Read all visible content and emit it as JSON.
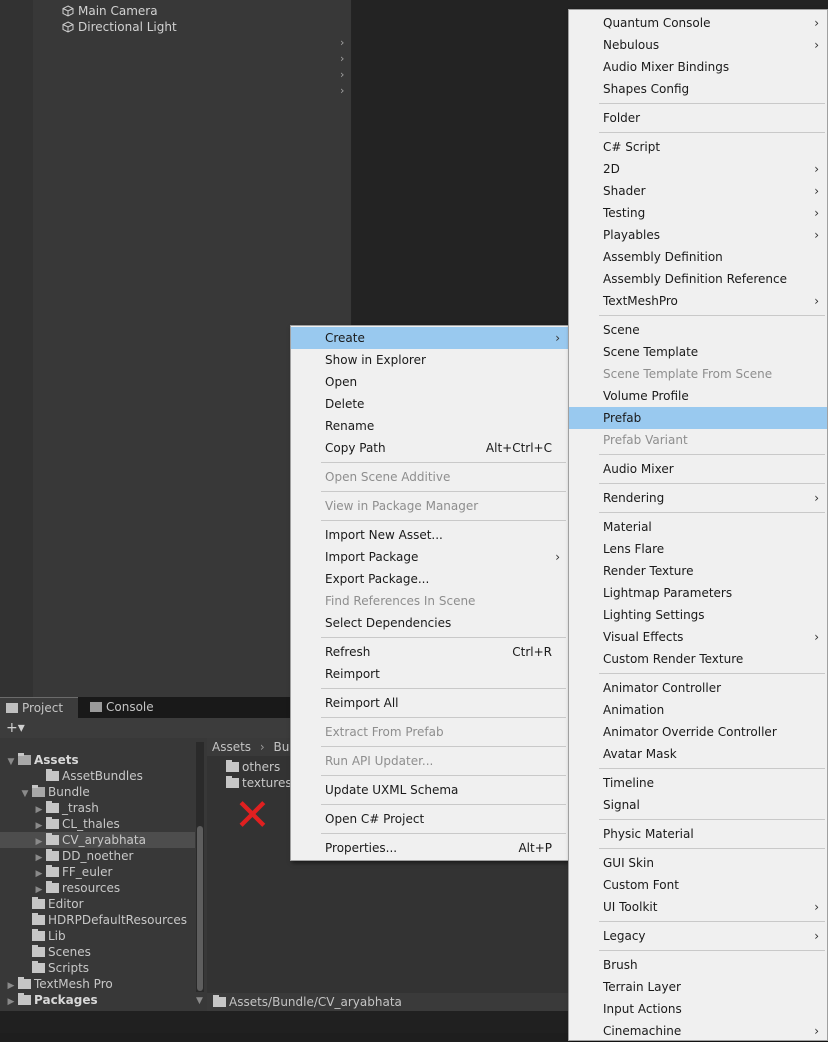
{
  "hierarchy": {
    "items": [
      {
        "label": "Main Camera",
        "icon": "gameobject-cube-icon"
      },
      {
        "label": "Directional Light",
        "icon": "gameobject-cube-icon"
      }
    ]
  },
  "tabs": {
    "project": "Project",
    "console": "Console"
  },
  "toolbar": {
    "add_label": "+▾"
  },
  "tree": [
    {
      "label": "Assets",
      "bold": true,
      "expanded": true
    },
    {
      "label": "AssetBundles"
    },
    {
      "label": "Bundle",
      "expanded": true
    },
    {
      "label": "_trash"
    },
    {
      "label": "CL_thales"
    },
    {
      "label": "CV_aryabhata",
      "selected": true
    },
    {
      "label": "DD_noether"
    },
    {
      "label": "FF_euler"
    },
    {
      "label": "resources"
    },
    {
      "label": "Editor"
    },
    {
      "label": "HDRPDefaultResources"
    },
    {
      "label": "Lib"
    },
    {
      "label": "Scenes"
    },
    {
      "label": "Scripts"
    },
    {
      "label": "TextMesh Pro"
    },
    {
      "label": "Packages",
      "bold": true
    }
  ],
  "breadcrumb": {
    "root": "Assets",
    "sep": "›",
    "next": "Bund"
  },
  "folder_items": [
    "others",
    "textures"
  ],
  "annotation": {
    "mark": "✕",
    "color": "#e02020"
  },
  "status_path": "Assets/Bundle/CV_aryabhata",
  "context_menu": {
    "items": [
      {
        "label": "Create",
        "submenu": true,
        "highlighted": true
      },
      {
        "label": "Show in Explorer"
      },
      {
        "label": "Open"
      },
      {
        "label": "Delete"
      },
      {
        "label": "Rename"
      },
      {
        "label": "Copy Path",
        "shortcut": "Alt+Ctrl+C"
      },
      {
        "sep": true
      },
      {
        "label": "Open Scene Additive",
        "disabled": true
      },
      {
        "sep": true
      },
      {
        "label": "View in Package Manager",
        "disabled": true
      },
      {
        "sep": true
      },
      {
        "label": "Import New Asset..."
      },
      {
        "label": "Import Package",
        "submenu": true
      },
      {
        "label": "Export Package..."
      },
      {
        "label": "Find References In Scene",
        "disabled": true
      },
      {
        "label": "Select Dependencies"
      },
      {
        "sep": true
      },
      {
        "label": "Refresh",
        "shortcut": "Ctrl+R"
      },
      {
        "label": "Reimport"
      },
      {
        "sep": true
      },
      {
        "label": "Reimport All"
      },
      {
        "sep": true
      },
      {
        "label": "Extract From Prefab",
        "disabled": true
      },
      {
        "sep": true
      },
      {
        "label": "Run API Updater...",
        "disabled": true
      },
      {
        "sep": true
      },
      {
        "label": "Update UXML Schema"
      },
      {
        "sep": true
      },
      {
        "label": "Open C# Project"
      },
      {
        "sep": true
      },
      {
        "label": "Properties...",
        "shortcut": "Alt+P"
      }
    ]
  },
  "create_menu": {
    "items": [
      {
        "label": "Quantum Console",
        "submenu": true
      },
      {
        "label": "Nebulous",
        "submenu": true
      },
      {
        "label": "Audio Mixer Bindings"
      },
      {
        "label": "Shapes Config"
      },
      {
        "sep": true
      },
      {
        "label": "Folder"
      },
      {
        "sep": true
      },
      {
        "label": "C# Script"
      },
      {
        "label": "2D",
        "submenu": true
      },
      {
        "label": "Shader",
        "submenu": true
      },
      {
        "label": "Testing",
        "submenu": true
      },
      {
        "label": "Playables",
        "submenu": true
      },
      {
        "label": "Assembly Definition"
      },
      {
        "label": "Assembly Definition Reference"
      },
      {
        "label": "TextMeshPro",
        "submenu": true
      },
      {
        "sep": true
      },
      {
        "label": "Scene"
      },
      {
        "label": "Scene Template"
      },
      {
        "label": "Scene Template From Scene",
        "disabled": true
      },
      {
        "label": "Volume Profile"
      },
      {
        "label": "Prefab",
        "highlighted": true
      },
      {
        "label": "Prefab Variant",
        "disabled": true
      },
      {
        "sep": true
      },
      {
        "label": "Audio Mixer"
      },
      {
        "sep": true
      },
      {
        "label": "Rendering",
        "submenu": true
      },
      {
        "sep": true
      },
      {
        "label": "Material"
      },
      {
        "label": "Lens Flare"
      },
      {
        "label": "Render Texture"
      },
      {
        "label": "Lightmap Parameters"
      },
      {
        "label": "Lighting Settings"
      },
      {
        "label": "Visual Effects",
        "submenu": true
      },
      {
        "label": "Custom Render Texture"
      },
      {
        "sep": true
      },
      {
        "label": "Animator Controller"
      },
      {
        "label": "Animation"
      },
      {
        "label": "Animator Override Controller"
      },
      {
        "label": "Avatar Mask"
      },
      {
        "sep": true
      },
      {
        "label": "Timeline"
      },
      {
        "label": "Signal"
      },
      {
        "sep": true
      },
      {
        "label": "Physic Material"
      },
      {
        "sep": true
      },
      {
        "label": "GUI Skin"
      },
      {
        "label": "Custom Font"
      },
      {
        "label": "UI Toolkit",
        "submenu": true
      },
      {
        "sep": true
      },
      {
        "label": "Legacy",
        "submenu": true
      },
      {
        "sep": true
      },
      {
        "label": "Brush"
      },
      {
        "label": "Terrain Layer"
      },
      {
        "label": "Input Actions"
      },
      {
        "label": "Cinemachine",
        "submenu": true
      }
    ]
  },
  "submenu_glyph": "›"
}
